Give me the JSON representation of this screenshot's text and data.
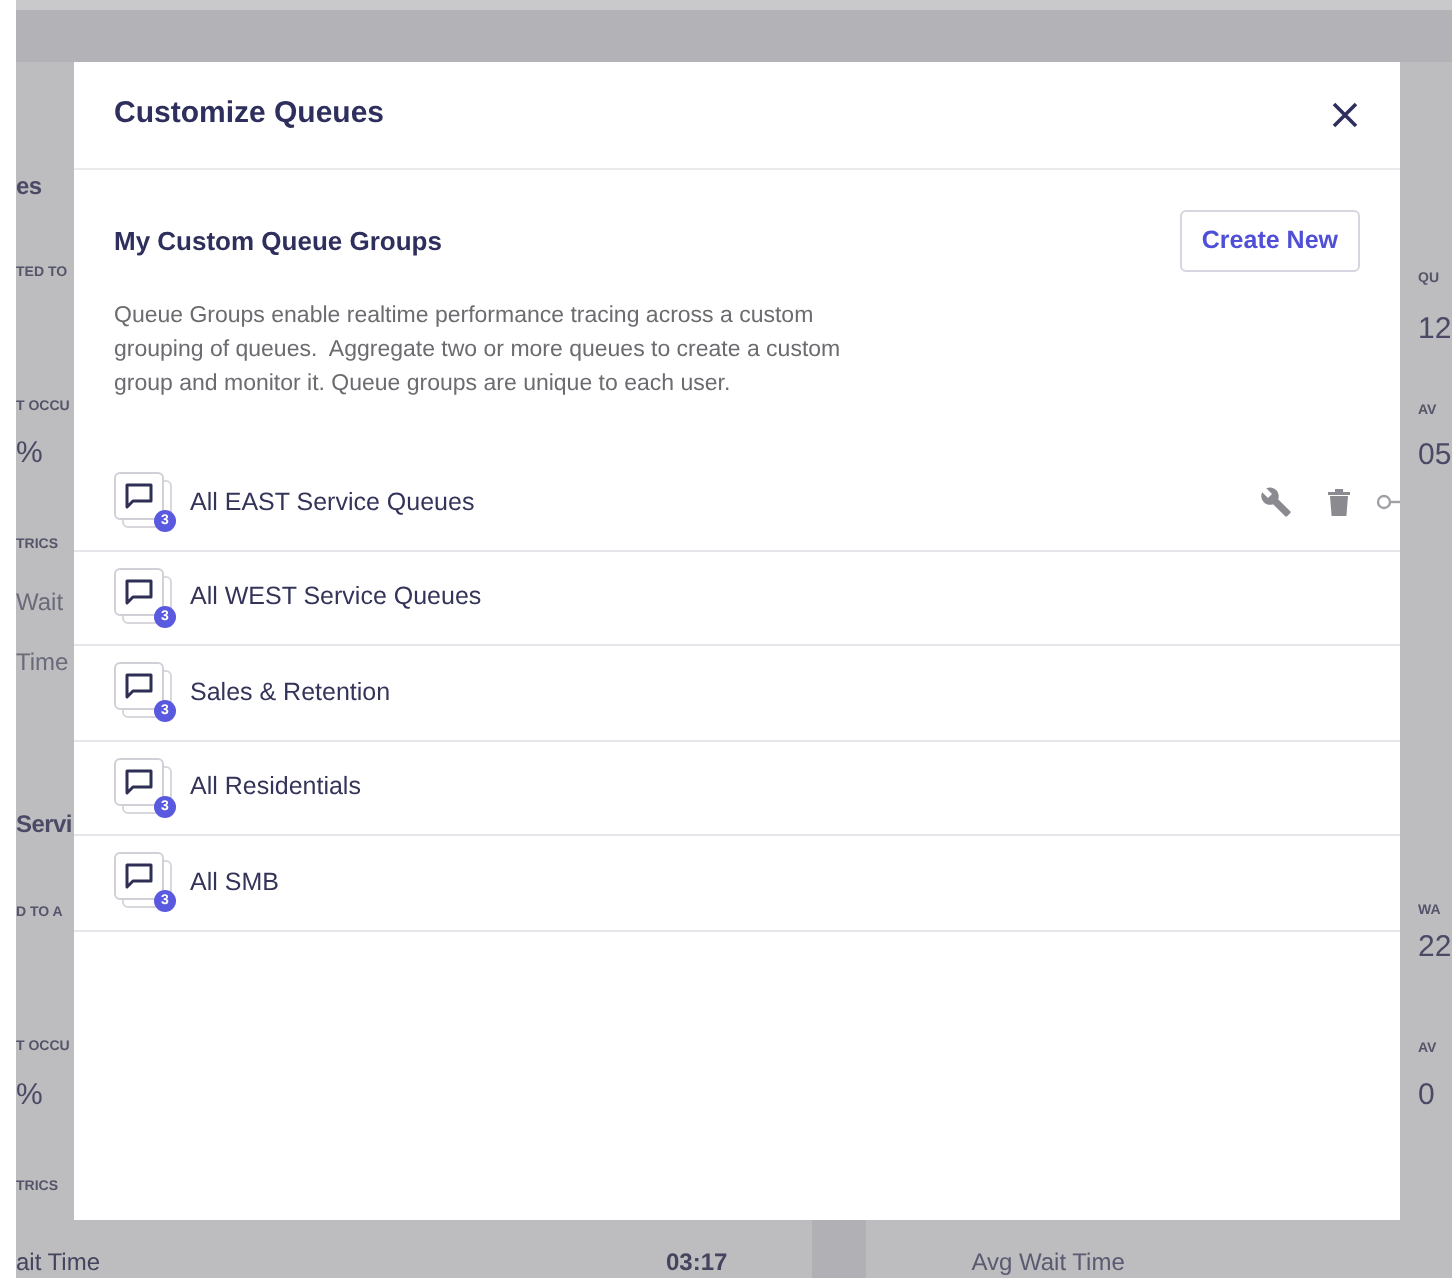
{
  "background": {
    "left_texts": [
      {
        "text": "es",
        "kind": "heading"
      },
      {
        "text": "TED TO",
        "kind": "caption"
      },
      {
        "text": "T OCCU",
        "kind": "caption"
      },
      {
        "text": "%",
        "kind": "value"
      },
      {
        "text": "TRICS",
        "kind": "caption"
      },
      {
        "text": "Wait",
        "kind": "label"
      },
      {
        "text": "Time",
        "kind": "label"
      },
      {
        "text": "Servi",
        "kind": "heading"
      },
      {
        "text": "D TO A",
        "kind": "caption"
      },
      {
        "text": "T OCCU",
        "kind": "caption"
      },
      {
        "text": "%",
        "kind": "value"
      },
      {
        "text": "TRICS",
        "kind": "caption"
      }
    ],
    "right_texts": [
      {
        "text": "QU",
        "kind": "caption"
      },
      {
        "text": "12",
        "kind": "value"
      },
      {
        "text": "AV",
        "kind": "caption"
      },
      {
        "text": "05",
        "kind": "value"
      },
      {
        "text": "WA",
        "kind": "caption"
      },
      {
        "text": "22",
        "kind": "value"
      },
      {
        "text": "AV",
        "kind": "caption"
      },
      {
        "text": "0",
        "kind": "value"
      }
    ],
    "bottom": {
      "left_label": "ait Time",
      "left_value": "03:17",
      "right_label": "Avg Wait Time"
    }
  },
  "dialog": {
    "title": "Customize Queues",
    "section_title": "My Custom Queue Groups",
    "create_button": "Create New",
    "description": "Queue Groups enable realtime performance tracing across a custom grouping of queues.  Aggregate two or more queues to create a custom group and monitor it. Queue groups are unique to each user.",
    "groups": [
      {
        "name": "All EAST Service Queues",
        "count": "3",
        "hovered": true
      },
      {
        "name": "All WEST Service Queues",
        "count": "3",
        "hovered": false
      },
      {
        "name": "Sales & Retention",
        "count": "3",
        "hovered": false
      },
      {
        "name": "All Residentials",
        "count": "3",
        "hovered": false
      },
      {
        "name": "All SMB",
        "count": "3",
        "hovered": false
      }
    ]
  }
}
